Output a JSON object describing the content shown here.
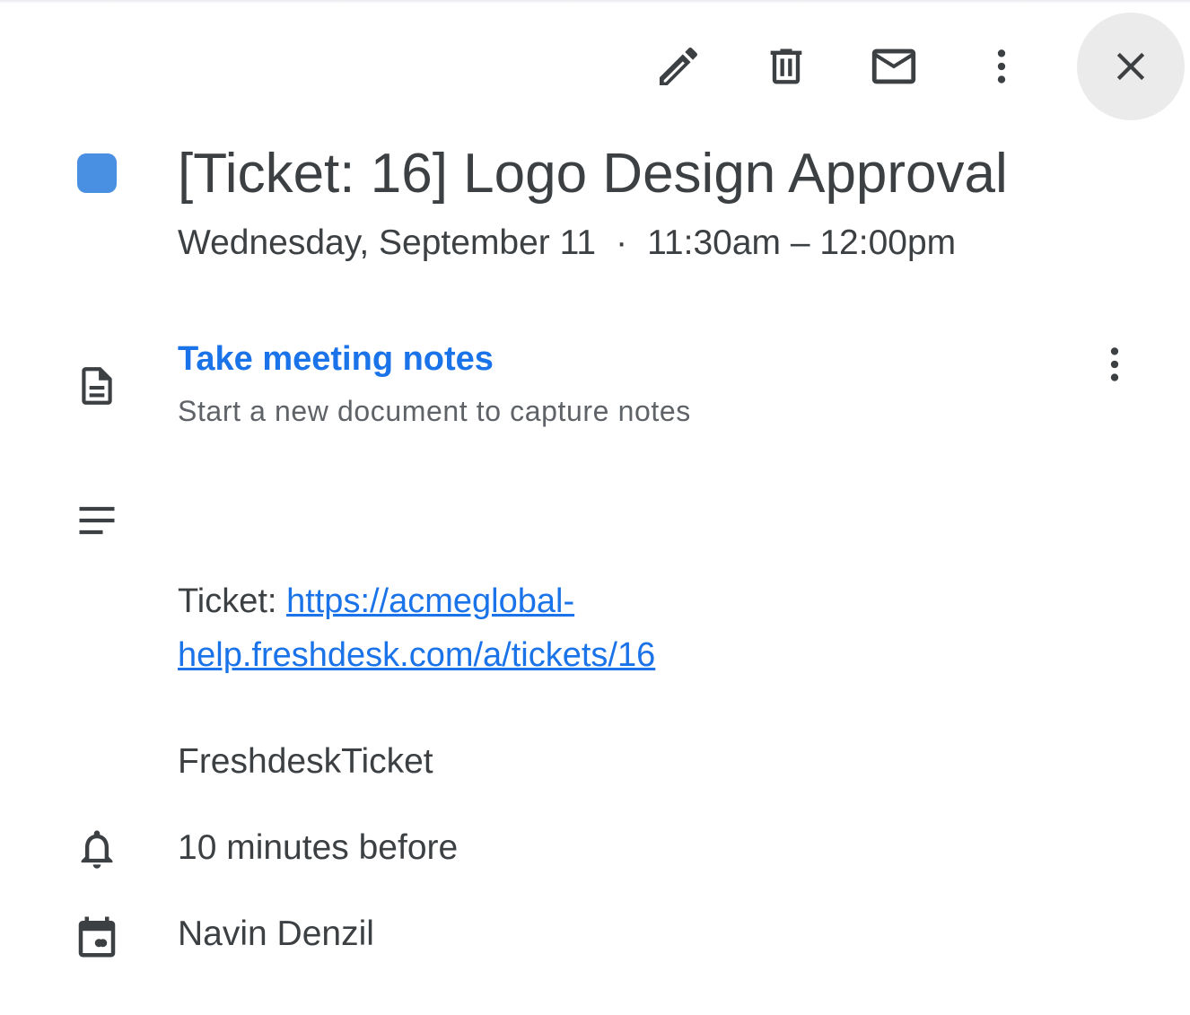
{
  "toolbar": {
    "edit_icon": "pencil-icon",
    "delete_icon": "trash-icon",
    "email_icon": "envelope-icon",
    "more_icon": "more-vert-icon",
    "close_icon": "close-icon"
  },
  "event": {
    "color": "#4a90e2",
    "title": "[Ticket: 16] Logo Design Approval",
    "date": "Wednesday, September 11",
    "separator": "·",
    "time": "11:30am – 12:00pm"
  },
  "notes": {
    "link_label": "Take meeting notes",
    "subtitle": "Start a new document to capture notes"
  },
  "description": {
    "prefix": "Ticket: ",
    "link_line1": "https://acmeglobal-",
    "link_line2": "help.freshdesk.com/a/tickets/16",
    "tag": "FreshdeskTicket"
  },
  "reminder": {
    "label": "10 minutes before"
  },
  "calendar": {
    "owner": "Navin Denzil"
  },
  "colors": {
    "text": "#3c4043",
    "secondary_text": "#5f6368",
    "link": "#1a73e8",
    "close_bg": "#ebebeb"
  }
}
